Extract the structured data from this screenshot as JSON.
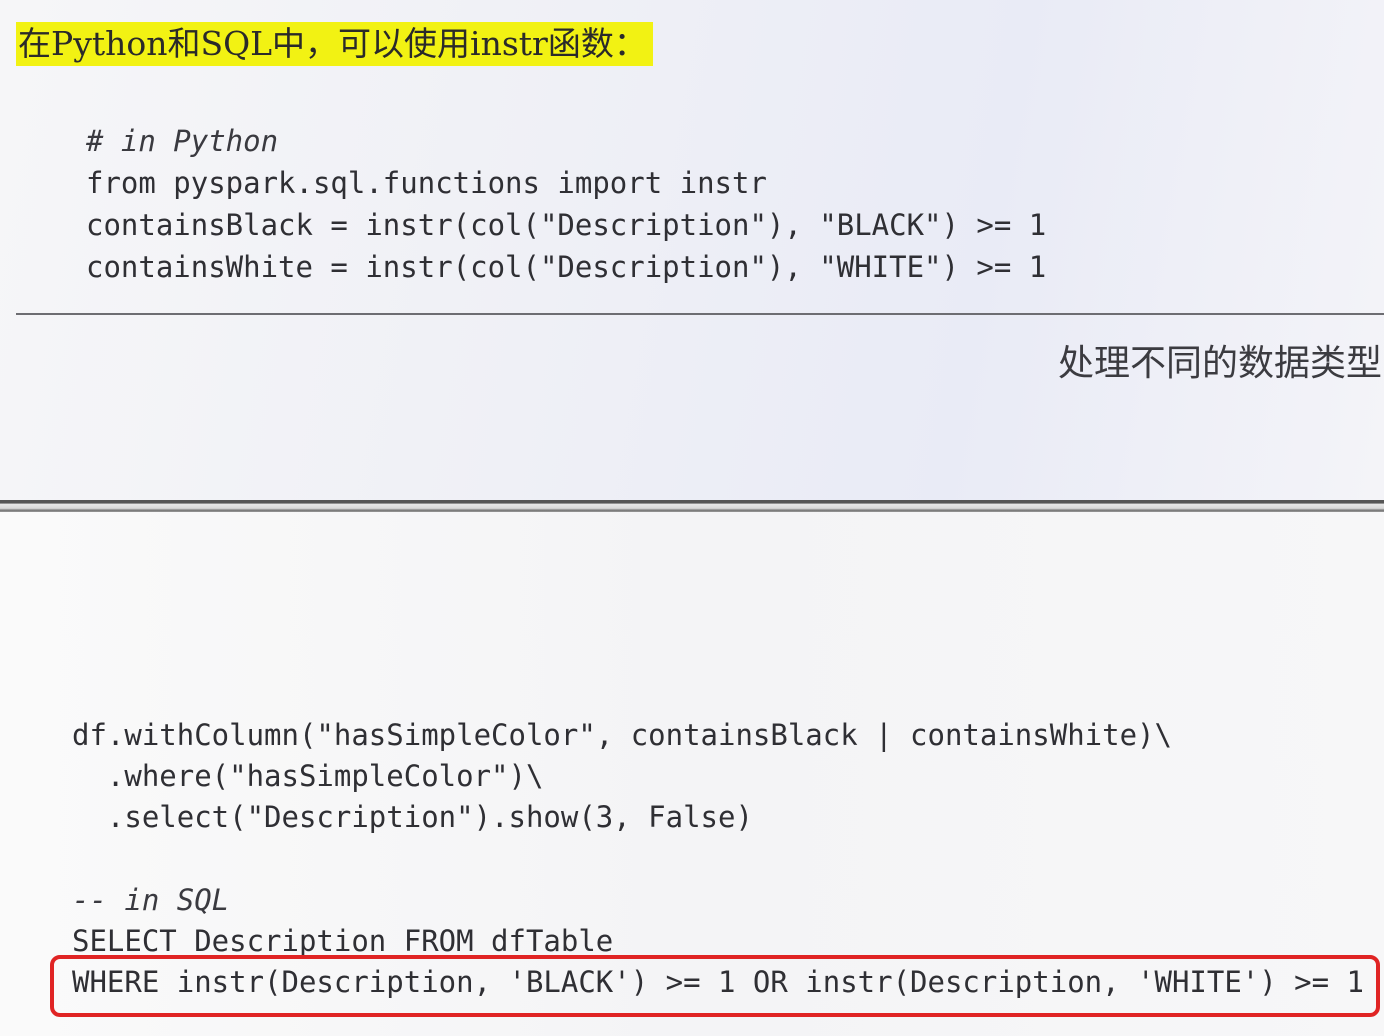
{
  "intro": {
    "text": "在Python和SQL中，可以使用instr函数："
  },
  "python_code": {
    "comment": "# in Python",
    "lines": [
      "from pyspark.sql.functions import instr",
      "containsBlack = instr(col(\"Description\"), \"BLACK\") >= 1",
      "containsWhite = instr(col(\"Description\"), \"WHITE\") >= 1"
    ]
  },
  "section_title": "处理不同的数据类型",
  "df_code": {
    "lines": [
      "df.withColumn(\"hasSimpleColor\", containsBlack | containsWhite)\\",
      "  .where(\"hasSimpleColor\")\\",
      "  .select(\"Description\").show(3, False)"
    ]
  },
  "sql_code": {
    "comment": "-- in SQL",
    "lines": [
      "SELECT Description FROM dfTable",
      "WHERE instr(Description, 'BLACK') >= 1 OR instr(Description, 'WHITE') >= 1"
    ]
  },
  "colors": {
    "highlight_marker": "#f2f213",
    "annotation_box": "#e02424"
  }
}
